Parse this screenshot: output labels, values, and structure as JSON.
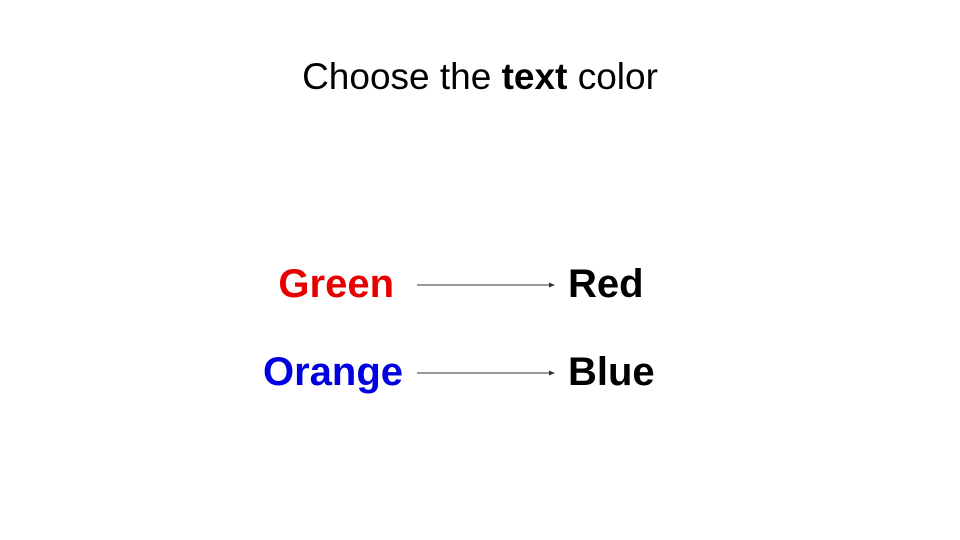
{
  "title": {
    "prefix": "Choose the ",
    "emphasis": "text",
    "suffix": " color"
  },
  "pairs": [
    {
      "left": "Green",
      "left_color": "#e60000",
      "right": "Red"
    },
    {
      "left": "Orange",
      "left_color": "#0000e0",
      "right": "Blue"
    }
  ],
  "colors": {
    "background": "#ffffff",
    "text": "#000000",
    "arrow": "#333333"
  },
  "icons": [
    "arrow-right-icon"
  ]
}
